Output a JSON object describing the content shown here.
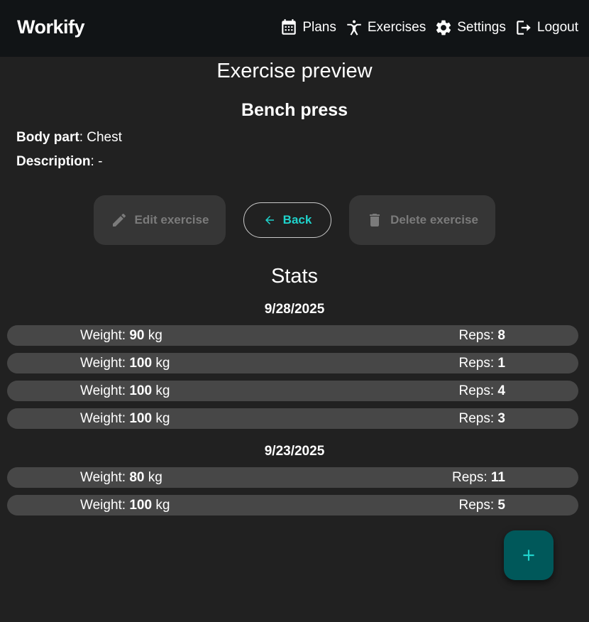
{
  "app": {
    "brand": "Workify",
    "nav": [
      {
        "label": "Plans",
        "icon": "calendar-icon"
      },
      {
        "label": "Exercises",
        "icon": "gymnastics-icon"
      },
      {
        "label": "Settings",
        "icon": "gear-icon"
      },
      {
        "label": "Logout",
        "icon": "logout-icon"
      }
    ]
  },
  "page": {
    "title": "Exercise preview",
    "exercise_name": "Bench press",
    "body_part_label": "Body part",
    "body_part_value": ": Chest",
    "description_label": "Description",
    "description_value": ": -"
  },
  "actions": {
    "edit_label": "Edit exercise",
    "back_label": "Back",
    "delete_label": "Delete exercise"
  },
  "stats": {
    "title": "Stats",
    "weight_label": "Weight: ",
    "weight_unit": " kg",
    "reps_label": "Reps: ",
    "sessions": [
      {
        "date": "9/28/2025",
        "sets": [
          {
            "weight": "90",
            "reps": "8"
          },
          {
            "weight": "100",
            "reps": "1"
          },
          {
            "weight": "100",
            "reps": "4"
          },
          {
            "weight": "100",
            "reps": "3"
          }
        ]
      },
      {
        "date": "9/23/2025",
        "sets": [
          {
            "weight": "80",
            "reps": "11"
          },
          {
            "weight": "100",
            "reps": "5"
          }
        ]
      }
    ]
  },
  "fab": {
    "label": "+",
    "icon": "plus-icon"
  },
  "colors": {
    "background": "#212121",
    "topbar": "#111416",
    "accent": "#1fd3cc",
    "fab": "#00585a",
    "row": "#474747",
    "disabled_button": "#363636"
  }
}
